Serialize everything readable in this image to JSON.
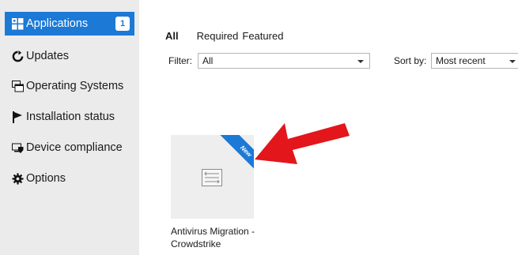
{
  "sidebar": {
    "items": [
      {
        "label": "Applications",
        "icon": "apps-grid-icon",
        "badge": "1",
        "active": true
      },
      {
        "label": "Updates",
        "icon": "refresh-icon"
      },
      {
        "label": "Operating Systems",
        "icon": "windows-stack-icon"
      },
      {
        "label": "Installation status",
        "icon": "flag-icon"
      },
      {
        "label": "Device compliance",
        "icon": "device-shield-icon"
      },
      {
        "label": "Options",
        "icon": "gear-icon"
      }
    ]
  },
  "tabs": [
    "All",
    "Required",
    "Featured"
  ],
  "filter": {
    "label": "Filter:",
    "value": "All"
  },
  "sort": {
    "label": "Sort by:",
    "value": "Most recent"
  },
  "app_tile": {
    "ribbon": "New",
    "title": "Antivirus Migration - Crowdstrike",
    "icon": "application-package-icon"
  },
  "colors": {
    "accent": "#1c79d6",
    "arrow": "#e3161b",
    "sidebar_bg": "#ebebeb",
    "tile_bg": "#eeeeee"
  }
}
